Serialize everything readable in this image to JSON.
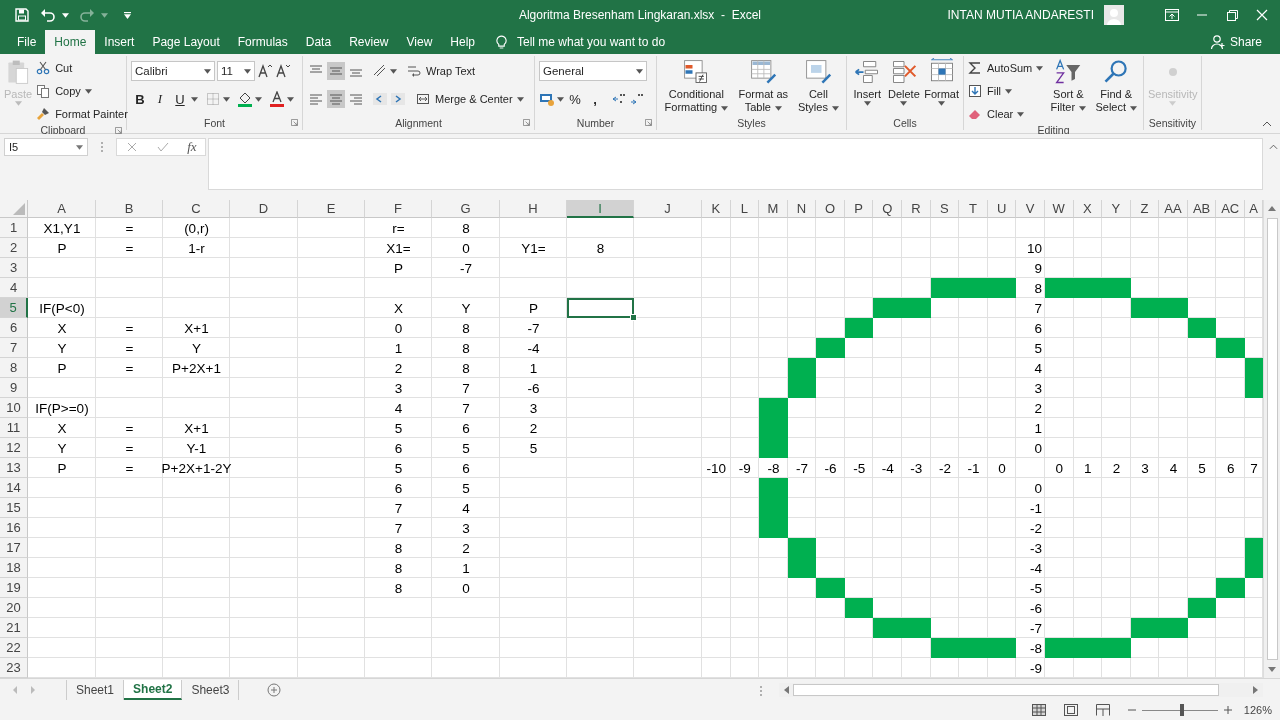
{
  "title_bar": {
    "title": "Algoritma Bresenham Lingkaran.xlsx  -  Excel",
    "user": "INTAN MUTIA ANDARESTI"
  },
  "tabs": [
    {
      "label": "File",
      "selected": false
    },
    {
      "label": "Home",
      "selected": true
    },
    {
      "label": "Insert",
      "selected": false
    },
    {
      "label": "Page Layout",
      "selected": false
    },
    {
      "label": "Formulas",
      "selected": false
    },
    {
      "label": "Data",
      "selected": false
    },
    {
      "label": "Review",
      "selected": false
    },
    {
      "label": "View",
      "selected": false
    },
    {
      "label": "Help",
      "selected": false
    }
  ],
  "tell_me": "Tell me what you want to do",
  "share": "Share",
  "ribbon": {
    "clipboard": {
      "label": "Clipboard",
      "paste": {
        "label": "Paste",
        "disabled": true
      },
      "cut": "Cut",
      "copy": "Copy",
      "format_painter": "Format Painter"
    },
    "font": {
      "label": "Font",
      "font_name": "Calibri",
      "font_size": "11",
      "bold": "B",
      "italic": "I",
      "underline": "U"
    },
    "alignment": {
      "label": "Alignment",
      "wrap_text": "Wrap Text",
      "merge_center": "Merge & Center"
    },
    "number": {
      "label": "Number",
      "format": "General",
      "percent": "%",
      "comma": ","
    },
    "styles": {
      "label": "Styles",
      "buttons": [
        "Conditional Formatting",
        "Format as Table",
        "Cell Styles"
      ]
    },
    "cells": {
      "label": "Cells",
      "buttons": [
        "Insert",
        "Delete",
        "Format"
      ]
    },
    "editing": {
      "label": "Editing",
      "autosum": "AutoSum",
      "fill": "Fill",
      "clear": "Clear",
      "sort_filter": "Sort & Filter",
      "find_select": "Find & Select"
    },
    "sensitivity": {
      "label": "Sensitivity",
      "button": {
        "label": "Sensitivity",
        "disabled": true
      }
    }
  },
  "formula_bar": {
    "name_box": "I5",
    "insert_function": "fx"
  },
  "sheet": {
    "columns": [
      {
        "label": "A",
        "selected": false
      },
      {
        "label": "B",
        "selected": false
      },
      {
        "label": "C",
        "selected": false
      },
      {
        "label": "D",
        "selected": false
      },
      {
        "label": "E",
        "selected": false
      },
      {
        "label": "F",
        "selected": false
      },
      {
        "label": "G",
        "selected": false
      },
      {
        "label": "H",
        "selected": false
      },
      {
        "label": "I",
        "selected": true
      },
      {
        "label": "J",
        "selected": false
      },
      {
        "label": "K",
        "selected": false
      },
      {
        "label": "L",
        "selected": false
      },
      {
        "label": "M",
        "selected": false
      },
      {
        "label": "N",
        "selected": false
      },
      {
        "label": "O",
        "selected": false
      },
      {
        "label": "P",
        "selected": false
      },
      {
        "label": "Q",
        "selected": false
      },
      {
        "label": "R",
        "selected": false
      },
      {
        "label": "S",
        "selected": false
      },
      {
        "label": "T",
        "selected": false
      },
      {
        "label": "U",
        "selected": false
      },
      {
        "label": "V",
        "selected": false
      },
      {
        "label": "W",
        "selected": false
      },
      {
        "label": "X",
        "selected": false
      },
      {
        "label": "Y",
        "selected": false
      },
      {
        "label": "Z",
        "selected": false
      },
      {
        "label": "AA",
        "selected": false
      },
      {
        "label": "AB",
        "selected": false
      },
      {
        "label": "AC",
        "selected": false
      },
      {
        "label": "A",
        "selected": false
      }
    ],
    "rows": [
      {
        "label": "1",
        "selected": false,
        "cells": [
          "X1,Y1",
          "=",
          "(0,r)",
          "",
          "",
          "r=",
          "8"
        ]
      },
      {
        "label": "2",
        "selected": false,
        "cells": [
          "P",
          "=",
          "1-r",
          "",
          "",
          "X1=",
          "0",
          "Y1=",
          "8",
          "",
          "",
          "",
          "",
          "",
          "",
          "",
          "",
          "",
          "",
          "",
          "",
          "10"
        ]
      },
      {
        "label": "3",
        "selected": false,
        "cells": [
          "",
          "",
          "",
          "",
          "",
          "P",
          "-7",
          "",
          "",
          "",
          "",
          "",
          "",
          "",
          "",
          "",
          "",
          "",
          "",
          "",
          "",
          "9"
        ]
      },
      {
        "label": "4",
        "selected": false,
        "cells": [
          "",
          "",
          "",
          "",
          "",
          "",
          "",
          "",
          "",
          "",
          "",
          "",
          "",
          "",
          "",
          "",
          "",
          "",
          {
            "filled": true
          },
          {
            "filled": true
          },
          {
            "filled": true
          },
          "8",
          {
            "filled": true
          },
          {
            "filled": true
          },
          {
            "filled": true
          }
        ]
      },
      {
        "label": "5",
        "selected": true,
        "cells": [
          "IF(P<0)",
          "",
          "",
          "",
          "",
          "X",
          "Y",
          "P",
          "",
          "",
          "",
          "",
          "",
          "",
          "",
          "",
          {
            "filled": true
          },
          {
            "filled": true
          },
          "",
          "",
          "",
          "7",
          "",
          "",
          "",
          {
            "filled": true
          },
          {
            "filled": true
          }
        ]
      },
      {
        "label": "6",
        "selected": false,
        "cells": [
          "X",
          "=",
          "X+1",
          "",
          "",
          "0",
          "8",
          "-7",
          "",
          "",
          "",
          "",
          "",
          "",
          "",
          {
            "filled": true
          },
          "",
          "",
          "",
          "",
          "",
          "6",
          "",
          "",
          "",
          "",
          "",
          {
            "filled": true
          }
        ]
      },
      {
        "label": "7",
        "selected": false,
        "cells": [
          "Y",
          "=",
          "Y",
          "",
          "",
          "1",
          "8",
          "-4",
          "",
          "",
          "",
          "",
          "",
          "",
          {
            "filled": true
          },
          "",
          "",
          "",
          "",
          "",
          "",
          "5",
          "",
          "",
          "",
          "",
          "",
          "",
          {
            "filled": true
          }
        ]
      },
      {
        "label": "8",
        "selected": false,
        "cells": [
          "P",
          "=",
          "P+2X+1",
          "",
          "",
          "2",
          "8",
          "1",
          "",
          "",
          "",
          "",
          "",
          {
            "filled": true
          },
          "",
          "",
          "",
          "",
          "",
          "",
          "",
          "4",
          "",
          "",
          "",
          "",
          "",
          "",
          "",
          {
            "filled": true
          }
        ]
      },
      {
        "label": "9",
        "selected": false,
        "cells": [
          "",
          "",
          "",
          "",
          "",
          "3",
          "7",
          "-6",
          "",
          "",
          "",
          "",
          "",
          {
            "filled": true
          },
          "",
          "",
          "",
          "",
          "",
          "",
          "",
          "3",
          "",
          "",
          "",
          "",
          "",
          "",
          "",
          {
            "filled": true
          }
        ]
      },
      {
        "label": "10",
        "selected": false,
        "cells": [
          "IF(P>=0)",
          "",
          "",
          "",
          "",
          "4",
          "7",
          "3",
          "",
          "",
          "",
          "",
          {
            "filled": true
          },
          "",
          "",
          "",
          "",
          "",
          "",
          "",
          "",
          "2"
        ]
      },
      {
        "label": "11",
        "selected": false,
        "cells": [
          "X",
          "=",
          "X+1",
          "",
          "",
          "5",
          "6",
          "2",
          "",
          "",
          "",
          "",
          {
            "filled": true
          },
          "",
          "",
          "",
          "",
          "",
          "",
          "",
          "",
          "1"
        ]
      },
      {
        "label": "12",
        "selected": false,
        "cells": [
          "Y",
          "=",
          "Y-1",
          "",
          "",
          "6",
          "5",
          "5",
          "",
          "",
          "",
          "",
          {
            "filled": true
          },
          "",
          "",
          "",
          "",
          "",
          "",
          "",
          "",
          "0"
        ]
      },
      {
        "label": "13",
        "selected": false,
        "cells": [
          "P",
          "=",
          "P+2X+1-2Y",
          "",
          "",
          "5",
          "6",
          "",
          "",
          "",
          "-10",
          "-9",
          "-8",
          "-7",
          "-6",
          "-5",
          "-4",
          "-3",
          "-2",
          "-1",
          "0",
          "",
          "0",
          "1",
          "2",
          "3",
          "4",
          "5",
          "6",
          "7"
        ]
      },
      {
        "label": "14",
        "selected": false,
        "cells": [
          "",
          "",
          "",
          "",
          "",
          "6",
          "5",
          "",
          "",
          "",
          "",
          "",
          {
            "filled": true
          },
          "",
          "",
          "",
          "",
          "",
          "",
          "",
          "",
          "0"
        ]
      },
      {
        "label": "15",
        "selected": false,
        "cells": [
          "",
          "",
          "",
          "",
          "",
          "7",
          "4",
          "",
          "",
          "",
          "",
          "",
          {
            "filled": true
          },
          "",
          "",
          "",
          "",
          "",
          "",
          "",
          "",
          "-1"
        ]
      },
      {
        "label": "16",
        "selected": false,
        "cells": [
          "",
          "",
          "",
          "",
          "",
          "7",
          "3",
          "",
          "",
          "",
          "",
          "",
          {
            "filled": true
          },
          "",
          "",
          "",
          "",
          "",
          "",
          "",
          "",
          "-2"
        ]
      },
      {
        "label": "17",
        "selected": false,
        "cells": [
          "",
          "",
          "",
          "",
          "",
          "8",
          "2",
          "",
          "",
          "",
          "",
          "",
          "",
          {
            "filled": true
          },
          "",
          "",
          "",
          "",
          "",
          "",
          "",
          "-3",
          "",
          "",
          "",
          "",
          "",
          "",
          "",
          {
            "filled": true
          }
        ]
      },
      {
        "label": "18",
        "selected": false,
        "cells": [
          "",
          "",
          "",
          "",
          "",
          "8",
          "1",
          "",
          "",
          "",
          "",
          "",
          "",
          {
            "filled": true
          },
          "",
          "",
          "",
          "",
          "",
          "",
          "",
          "-4",
          "",
          "",
          "",
          "",
          "",
          "",
          "",
          {
            "filled": true
          }
        ]
      },
      {
        "label": "19",
        "selected": false,
        "cells": [
          "",
          "",
          "",
          "",
          "",
          "8",
          "0",
          "",
          "",
          "",
          "",
          "",
          "",
          "",
          {
            "filled": true
          },
          "",
          "",
          "",
          "",
          "",
          "",
          "-5",
          "",
          "",
          "",
          "",
          "",
          "",
          {
            "filled": true
          }
        ]
      },
      {
        "label": "20",
        "selected": false,
        "cells": [
          "",
          "",
          "",
          "",
          "",
          "",
          "",
          "",
          "",
          "",
          "",
          "",
          "",
          "",
          "",
          {
            "filled": true
          },
          "",
          "",
          "",
          "",
          "",
          "-6",
          "",
          "",
          "",
          "",
          "",
          {
            "filled": true
          }
        ]
      },
      {
        "label": "21",
        "selected": false,
        "cells": [
          "",
          "",
          "",
          "",
          "",
          "",
          "",
          "",
          "",
          "",
          "",
          "",
          "",
          "",
          "",
          "",
          {
            "filled": true
          },
          {
            "filled": true
          },
          "",
          "",
          "",
          "-7",
          "",
          "",
          "",
          {
            "filled": true
          },
          {
            "filled": true
          }
        ]
      },
      {
        "label": "22",
        "selected": false,
        "cells": [
          "",
          "",
          "",
          "",
          "",
          "",
          "",
          "",
          "",
          "",
          "",
          "",
          "",
          "",
          "",
          "",
          "",
          "",
          {
            "filled": true
          },
          {
            "filled": true
          },
          {
            "filled": true
          },
          "-8",
          {
            "filled": true
          },
          {
            "filled": true
          },
          {
            "filled": true
          }
        ]
      },
      {
        "label": "23",
        "selected": false,
        "cells": [
          "",
          "",
          "",
          "",
          "",
          "",
          "",
          "",
          "",
          "",
          "",
          "",
          "",
          "",
          "",
          "",
          "",
          "",
          "",
          "",
          "",
          "-9"
        ]
      }
    ]
  },
  "sheet_tabs": [
    {
      "label": "Sheet1",
      "selected": false
    },
    {
      "label": "Sheet2",
      "selected": true
    },
    {
      "label": "Sheet3",
      "selected": false
    }
  ],
  "status_bar": {
    "zoom": {
      "level": 0.53,
      "reading": "126%"
    }
  }
}
